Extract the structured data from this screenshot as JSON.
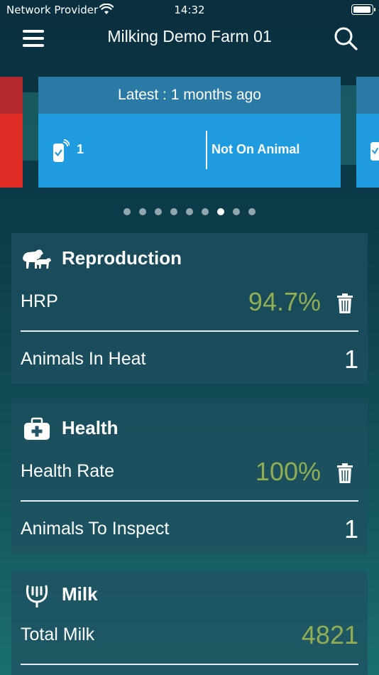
{
  "status_bar": {
    "carrier": "Network Provider",
    "time": "14:32"
  },
  "nav": {
    "title": "Milking Demo Farm 01"
  },
  "carousel": {
    "header": "Latest : 1 months ago",
    "count": "1",
    "status": "Not On Animal",
    "page_count": 9,
    "active_page": 7,
    "colors": {
      "card_header": "#2b7aa6",
      "card_body": "#1f9be0",
      "alert_red": "#e12b25"
    }
  },
  "reproduction": {
    "title": "Reproduction",
    "icon": "cow-calf-icon",
    "rows": [
      {
        "label": "HRP",
        "value": "94.7%"
      },
      {
        "label": "Animals In Heat",
        "value": "1"
      }
    ]
  },
  "health": {
    "title": "Health",
    "icon": "medical-kit-icon",
    "rows": [
      {
        "label": "Health Rate",
        "value": "100%"
      },
      {
        "label": "Animals To Inspect",
        "value": "1"
      }
    ]
  },
  "milk": {
    "title": "Milk",
    "icon": "milk-teat-icon",
    "rows": [
      {
        "label": "Total Milk",
        "value": "4821"
      }
    ]
  },
  "colors": {
    "value_green": "#93ad52"
  }
}
